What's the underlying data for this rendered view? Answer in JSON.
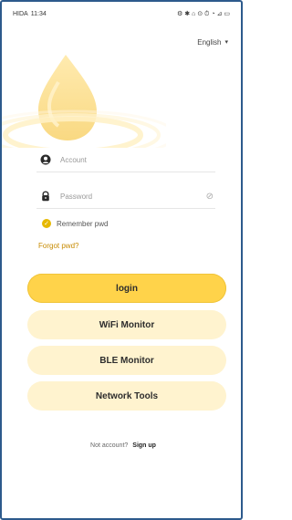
{
  "status_bar": {
    "time": "11:34",
    "left_small": "HIDA",
    "right_icons": "⚙ ✱ ⌂ ⊙ ⏱ ◔ ⊿ ▭"
  },
  "language": {
    "label": "English"
  },
  "form": {
    "account_placeholder": "Account",
    "password_placeholder": "Password",
    "remember_label": "Remember pwd",
    "forgot_label": "Forgot pwd?"
  },
  "buttons": {
    "login": "login",
    "wifi_monitor": "WiFi Monitor",
    "ble_monitor": "BLE Monitor",
    "network_tools": "Network Tools"
  },
  "footer": {
    "prompt": "Not account?",
    "signup": "Sign up"
  },
  "colors": {
    "brand_yellow": "#FFD34A",
    "soft_yellow": "#FFF3CF",
    "accent_gold": "#E6B800"
  },
  "icons": {
    "account": "user-icon",
    "password": "lock-icon",
    "visibility": "eye-off-icon",
    "dropdown": "chevron-down-icon",
    "remember": "check-icon"
  }
}
